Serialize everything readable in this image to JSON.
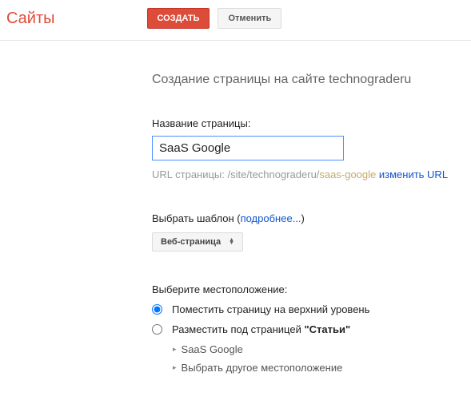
{
  "header": {
    "brand": "Сайты",
    "create": "СОЗДАТЬ",
    "cancel": "Отменить"
  },
  "title": "Создание страницы на сайте technograderu",
  "name_field": {
    "label": "Название страницы:",
    "value": "SaaS Google"
  },
  "url": {
    "prefix": "URL страницы: ",
    "path": "/site/technograderu/",
    "slug": "saas-google",
    "change": "изменить URL"
  },
  "template": {
    "label": "Выбрать шаблон (",
    "more": "подробнее...",
    "close": ")",
    "selected": "Веб-страница"
  },
  "location": {
    "label": "Выберите местоположение:",
    "option_top": "Поместить страницу на верхний уровень",
    "option_under_prefix": "Разместить под страницей ",
    "option_under_page": "\"Статьи\"",
    "tree_item": "SaaS Google",
    "tree_other": "Выбрать другое местоположение"
  }
}
